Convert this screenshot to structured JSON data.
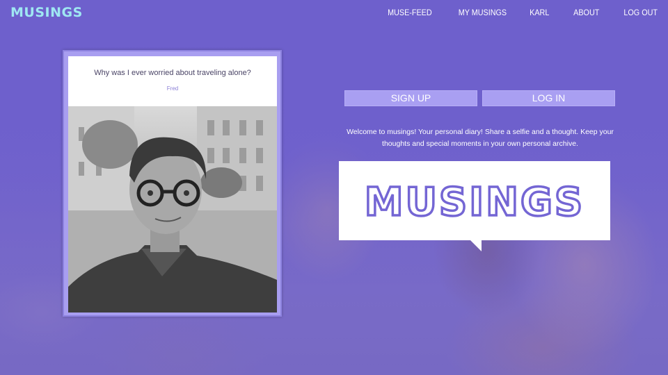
{
  "nav": {
    "brand": "MUSINGS",
    "links": [
      "MUSE-FEED",
      "MY MUSINGS",
      "KARL",
      "ABOUT",
      "LOG OUT"
    ]
  },
  "post": {
    "quote": "Why was I ever worried about traveling alone?",
    "author": "Fred"
  },
  "auth": {
    "signup_label": "SIGN UP",
    "login_label": "LOG IN"
  },
  "intro": "Welcome to musings! Your personal diary! Share a selfie and a thought. Keep your thoughts and special moments in your own personal archive.",
  "logo_word": "MUSINGS",
  "colors": {
    "background": "#6e60cc",
    "brand": "#9fe7f2",
    "button": "#a99ff2",
    "logo": "#7466d4"
  }
}
